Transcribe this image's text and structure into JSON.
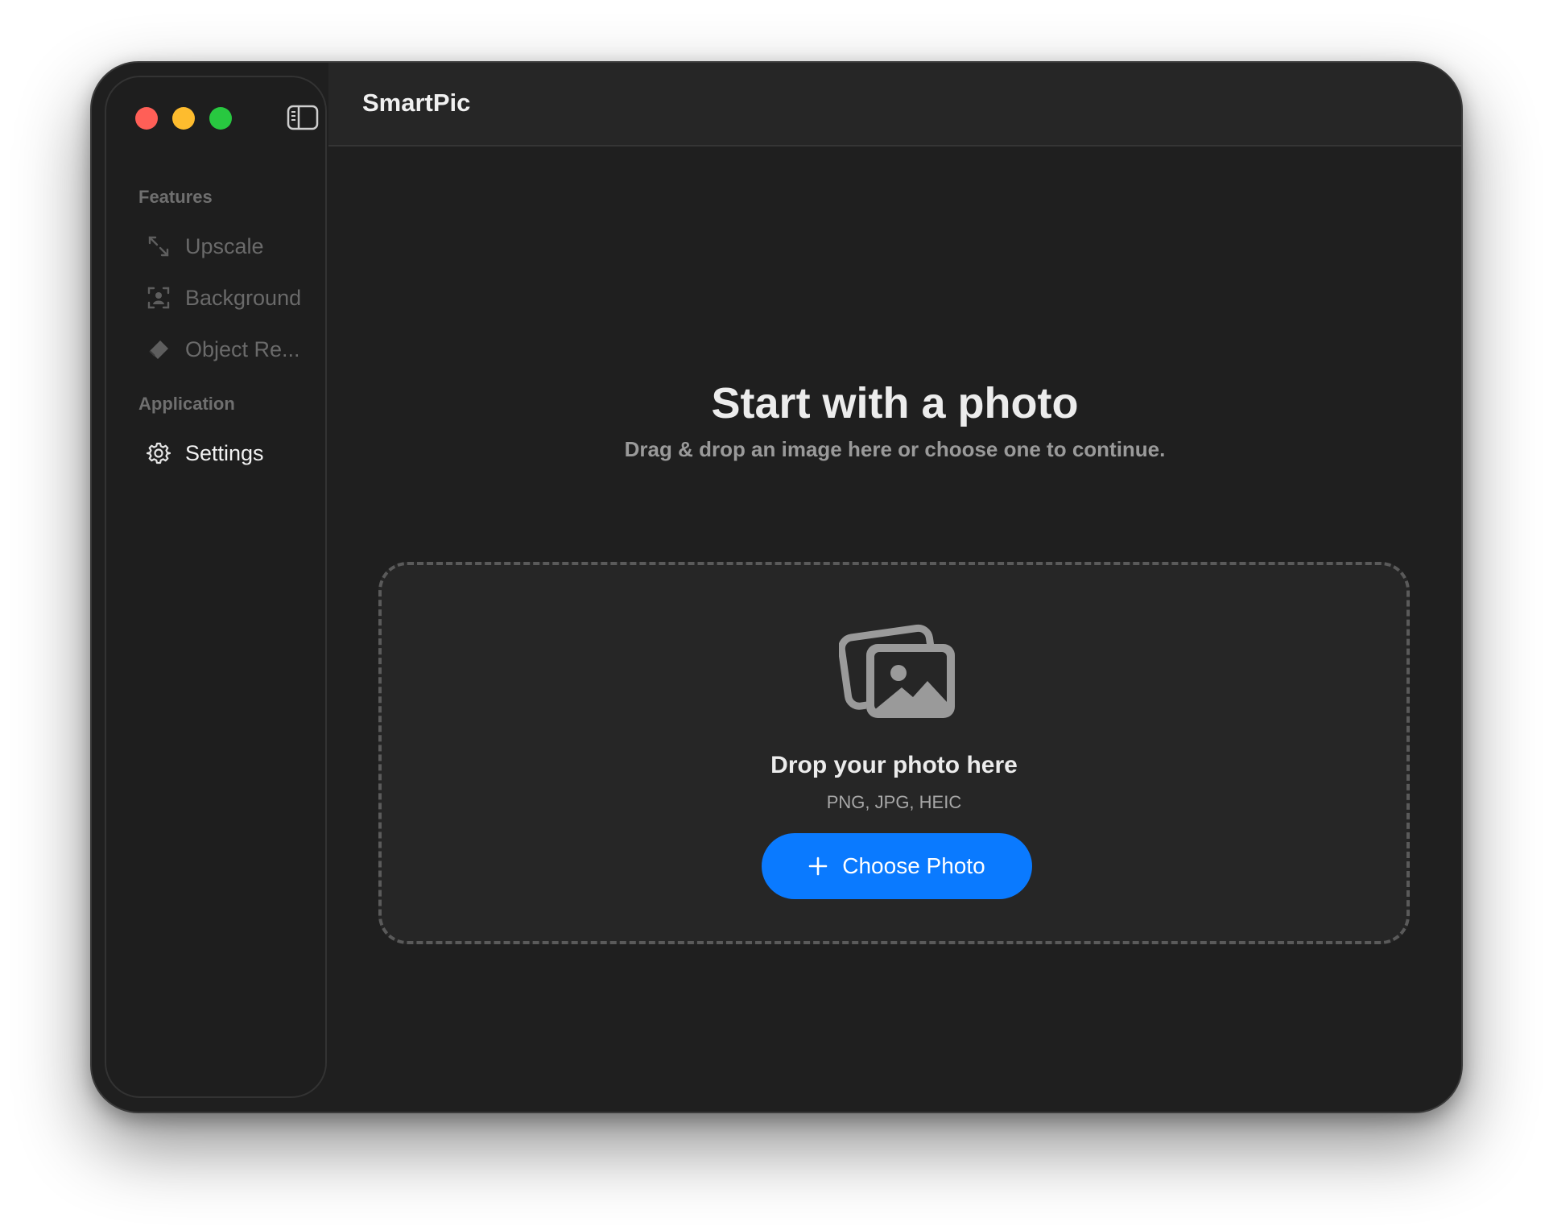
{
  "window": {
    "traffic_lights": [
      "close",
      "minimize",
      "zoom"
    ],
    "toggle_icon": "sidebar-toggle-icon"
  },
  "sidebar": {
    "sections": [
      {
        "header": "Features",
        "items": [
          {
            "label": "Upscale",
            "icon": "arrows-expand-icon",
            "state": "disabled"
          },
          {
            "label": "Background",
            "icon": "person-viewfinder-icon",
            "state": "disabled"
          },
          {
            "label": "Object Re...",
            "icon": "eraser-icon",
            "state": "disabled"
          }
        ]
      },
      {
        "header": "Application",
        "items": [
          {
            "label": "Settings",
            "icon": "gear-icon",
            "state": "active"
          }
        ]
      }
    ]
  },
  "titlebar": {
    "title": "SmartPic"
  },
  "main": {
    "headline": "Start with a photo",
    "subline": "Drag & drop an image here or choose one to continue.",
    "dropzone": {
      "icon": "photo-stack-icon",
      "title": "Drop your photo here",
      "formats": "PNG, JPG, HEIC",
      "button_label": "Choose Photo",
      "button_icon": "plus-icon"
    }
  },
  "colors": {
    "accent": "#0a7aff",
    "close": "#ff5f57",
    "minimize": "#febc2e",
    "zoom": "#28c840"
  }
}
